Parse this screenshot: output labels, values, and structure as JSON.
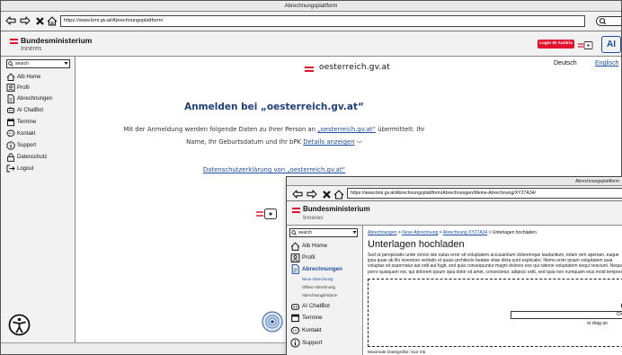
{
  "outer": {
    "window_title": "Abrechnungsplattform",
    "url": "https://www.bmi.gv.at/Abrechnungsplattform/",
    "ministry_name": "Bundesministerium",
    "ministry_sub": "Inneres",
    "login_button": "Login ID Austria",
    "ai_badge": "AI",
    "search_placeholder": "search",
    "sidebar": [
      {
        "label": "Alb Home",
        "icon": "home-icon"
      },
      {
        "label": "Profil",
        "icon": "profile-icon"
      },
      {
        "label": "Abrechnungen",
        "icon": "document-icon"
      },
      {
        "label": "AI ChatBot",
        "icon": "robot-icon"
      },
      {
        "label": "Termine",
        "icon": "calendar-icon"
      },
      {
        "label": "Kontakt",
        "icon": "chat-icon"
      },
      {
        "label": "Support",
        "icon": "info-icon"
      },
      {
        "label": "Datenschutz",
        "icon": "lock-icon"
      },
      {
        "label": "Logout",
        "icon": "logout-icon"
      }
    ],
    "lang_de": "Deutsch",
    "lang_en": "Englisch",
    "brand": "oesterreich.gv.at",
    "heading": "Anmelden bei „oesterreich.gv.at“",
    "body_line1_pre": "Mit der Anmeldung werden folgende Daten zu Ihrer Person an ",
    "body_line1_link": "„oesterreich.gv.at“",
    "body_line1_post": " übermittelt: Ihr",
    "body_line2_pre": "Name, Ihr Geburtsdatum und Ihr bPK ",
    "body_line2_link": "Details anzeigen",
    "privacy_link": "Datenschutzerklärung von „oesterreich.gv.at“"
  },
  "inner": {
    "window_title": "Abrechnungsplattform",
    "url": "https://www.bmi.gv.at/Abrechnungsplattform/Abrechnungen/Meine-Abrechnung/XY27A34/",
    "ministry_name": "Bundesministerium",
    "ministry_sub": "Inneres",
    "search_placeholder": "search",
    "sidebar": [
      {
        "label": "Alb Home"
      },
      {
        "label": "Profil"
      },
      {
        "label": "Abrechnungen"
      },
      {
        "label": "Neue Abrechnung"
      },
      {
        "label": "Offene Abrechnung"
      },
      {
        "label": "Abrechnungshistorie"
      },
      {
        "label": "AI ChatBot"
      },
      {
        "label": "Termine"
      },
      {
        "label": "Kontakt"
      },
      {
        "label": "Support"
      }
    ],
    "breadcrumb": [
      "Abrechnungen",
      "Neue Abrechnung",
      "Abrechnung XY27A34",
      "Unterlagen hochladen"
    ],
    "breadcrumb_sep": ">",
    "heading": "Unterlagen hochladen",
    "paragraph": "Sed ut perspiciatis unde omnis iste natus error sit voluptatem accusantium doloremque laudantium, totam rem aperiam, eaque ipsa quae ab illo inventore veritatis et quasi architecto beatae vitae dicta sunt explicabo. Nemo enim ipsam voluptatem quia voluptas sit aspernatur aut odit aut fugit, sed quia consequuntur magni dolores eos qui ratione voluptatem sequi nesciunt. Neque porro quisquam est, qui dolorem ipsum quia dolor sit amet, consectetur, adipisci velit, sed quia non numquam eius modi tempora incidunt ut labore et dolore magnam aliquam quaerat voluptatem.",
    "choose_button": "Choose",
    "drag_text": "or drag an",
    "max_size": "Maximale Dateigröße: 512 mb"
  }
}
